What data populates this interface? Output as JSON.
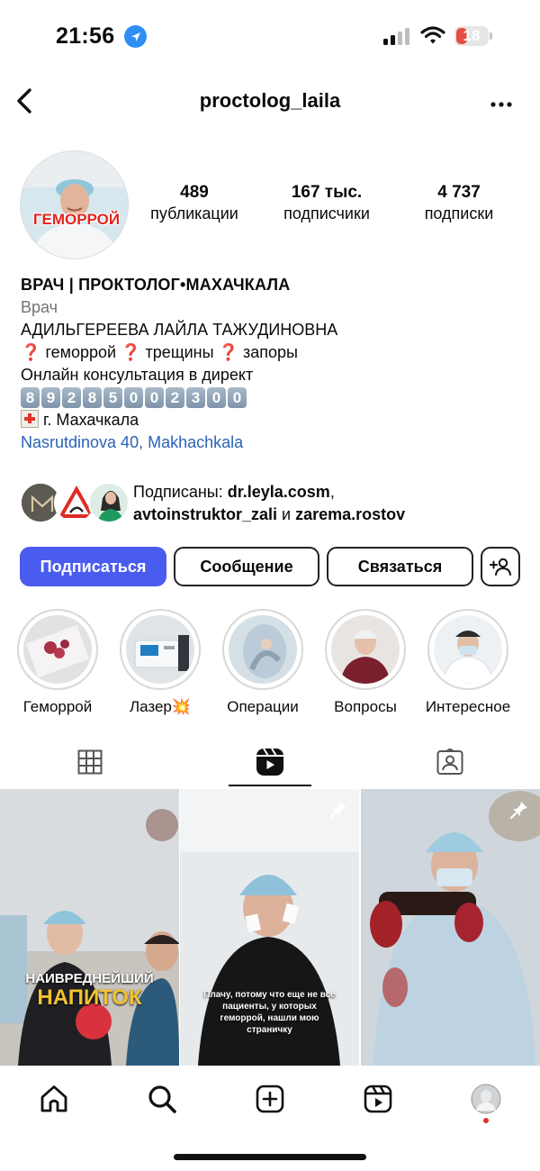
{
  "status_bar": {
    "time": "21:56",
    "battery_level": "18",
    "icons": [
      "location-arrow-icon",
      "cellular-signal-icon",
      "wifi-icon",
      "battery-icon"
    ]
  },
  "nav": {
    "title": "proctolog_laila",
    "more_label": "•••",
    "icons": [
      "back-chevron-icon",
      "more-dots-icon"
    ]
  },
  "profile": {
    "avatar_banner": "ГЕМОРРОЙ",
    "stats": [
      {
        "value": "489",
        "label": "публикации"
      },
      {
        "value": "167 тыс.",
        "label": "подписчики"
      },
      {
        "value": "4 737",
        "label": "подписки"
      }
    ]
  },
  "bio": {
    "name": "ВРАЧ | ПРОКТОЛОГ•МАХАЧКАЛА",
    "category": "Врач",
    "full_name": "АДИЛЬГЕРЕЕВА ЛАЙЛА ТАЖУДИНОВНА",
    "topics": [
      "геморрой",
      "трещины",
      "запоры"
    ],
    "topic_marker": "❓",
    "consult": "Онлайн консультация в директ",
    "phone_digits": [
      "8",
      "9",
      "2",
      "8",
      "5",
      "0",
      "0",
      "2",
      "3",
      "0",
      "0"
    ],
    "city": "г. Махачкала",
    "address_link": "Nasrutdinova 40, Makhachkala"
  },
  "followed_by": {
    "prefix": "Подписаны: ",
    "user1": "dr.leyla.cosm",
    "comma": ",",
    "user2": "avtoinstruktor_zali",
    "and": " и ",
    "user3": "zarema.rostov"
  },
  "actions": {
    "follow": "Подписаться",
    "message": "Сообщение",
    "contact": "Связаться",
    "suggest_icon": "add-person-icon"
  },
  "highlights": [
    {
      "label": "Геморрой"
    },
    {
      "label": "Лазер",
      "emoji": "💥"
    },
    {
      "label": "Операции"
    },
    {
      "label": "Вопросы"
    },
    {
      "label": "Интересное"
    }
  ],
  "tabs": [
    "grid-icon",
    "reels-icon",
    "tagged-icon"
  ],
  "active_tab": "reels",
  "reels": [
    {
      "caption_line1": "НАИВРЕДНЕЙШИЙ",
      "caption_line2": "НАПИТОК",
      "pinned": false
    },
    {
      "caption": "Плачу, потому что еще не все пациенты, у которых геморрой, нашли мою страничку",
      "pinned": true
    },
    {
      "caption": "",
      "pinned": true
    }
  ],
  "bottom_bar": [
    "home-icon",
    "search-icon",
    "create-post-icon",
    "reels-nav-icon",
    "profile-avatar-icon"
  ],
  "colors": {
    "primary_button": "#4a5cf0",
    "link": "#2a62b8",
    "notification_dot": "#e0332b",
    "battery_low": "#e54d42"
  }
}
